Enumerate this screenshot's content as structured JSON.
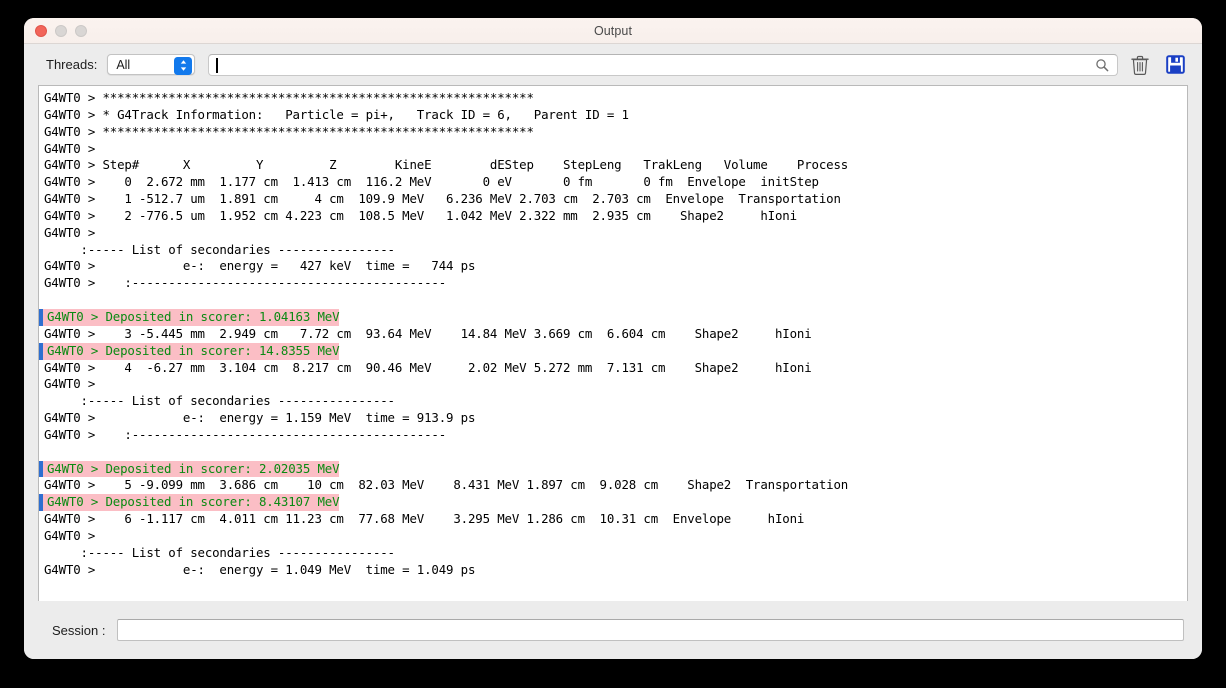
{
  "window": {
    "title": "Output",
    "traffic_lights": [
      "close",
      "minimize",
      "maximize"
    ]
  },
  "toolbar": {
    "threads_label": "Threads:",
    "threads_value": "All",
    "threads_options": [
      "All"
    ],
    "search_placeholder": "",
    "search_value": "",
    "search_icon": "search-icon",
    "clear_icon": "trash-icon",
    "save_icon": "save-floppy-icon"
  },
  "session": {
    "label": "Session :",
    "value": "",
    "placeholder": ""
  },
  "colors": {
    "highlight_background": "#fbbec5",
    "highlight_text": "#0a8a12",
    "highlight_bar": "#2f6fd0",
    "window_background": "#ececec",
    "titlebar_background": "#f8f0ec",
    "log_background": "#ffffff",
    "accent_blue": "#1279ec"
  },
  "log": {
    "lines": [
      {
        "text": "G4WT0 > ***********************************************************",
        "highlight": false
      },
      {
        "text": "G4WT0 > * G4Track Information:   Particle = pi+,   Track ID = 6,   Parent ID = 1",
        "highlight": false
      },
      {
        "text": "G4WT0 > ***********************************************************",
        "highlight": false
      },
      {
        "text": "G4WT0 > ",
        "highlight": false
      },
      {
        "text": "G4WT0 > Step#      X         Y         Z        KineE        dEStep    StepLeng   TrakLeng   Volume    Process",
        "highlight": false
      },
      {
        "text": "G4WT0 >    0  2.672 mm  1.177 cm  1.413 cm  116.2 MeV       0 eV       0 fm       0 fm  Envelope  initStep",
        "highlight": false
      },
      {
        "text": "G4WT0 >    1 -512.7 um  1.891 cm     4 cm  109.9 MeV   6.236 MeV 2.703 cm  2.703 cm  Envelope  Transportation",
        "highlight": false
      },
      {
        "text": "G4WT0 >    2 -776.5 um  1.952 cm 4.223 cm  108.5 MeV   1.042 MeV 2.322 mm  2.935 cm    Shape2     hIoni",
        "highlight": false
      },
      {
        "text": "G4WT0 > ",
        "highlight": false
      },
      {
        "text": "     :----- List of secondaries ----------------",
        "highlight": false
      },
      {
        "text": "G4WT0 >            e-:  energy =   427 keV  time =   744 ps",
        "highlight": false
      },
      {
        "text": "G4WT0 >    :-------------------------------------------",
        "highlight": false
      },
      {
        "text": "",
        "highlight": false
      },
      {
        "text": "G4WT0 > Deposited in scorer: 1.04163 MeV",
        "highlight": true
      },
      {
        "text": "G4WT0 >    3 -5.445 mm  2.949 cm   7.72 cm  93.64 MeV    14.84 MeV 3.669 cm  6.604 cm    Shape2     hIoni",
        "highlight": false
      },
      {
        "text": "G4WT0 > Deposited in scorer: 14.8355 MeV",
        "highlight": true
      },
      {
        "text": "G4WT0 >    4  -6.27 mm  3.104 cm  8.217 cm  90.46 MeV     2.02 MeV 5.272 mm  7.131 cm    Shape2     hIoni",
        "highlight": false
      },
      {
        "text": "G4WT0 > ",
        "highlight": false
      },
      {
        "text": "     :----- List of secondaries ----------------",
        "highlight": false
      },
      {
        "text": "G4WT0 >            e-:  energy = 1.159 MeV  time = 913.9 ps",
        "highlight": false
      },
      {
        "text": "G4WT0 >    :-------------------------------------------",
        "highlight": false
      },
      {
        "text": "",
        "highlight": false
      },
      {
        "text": "G4WT0 > Deposited in scorer: 2.02035 MeV",
        "highlight": true
      },
      {
        "text": "G4WT0 >    5 -9.099 mm  3.686 cm    10 cm  82.03 MeV    8.431 MeV 1.897 cm  9.028 cm    Shape2  Transportation",
        "highlight": false
      },
      {
        "text": "G4WT0 > Deposited in scorer: 8.43107 MeV",
        "highlight": true
      },
      {
        "text": "G4WT0 >    6 -1.117 cm  4.011 cm 11.23 cm  77.68 MeV    3.295 MeV 1.286 cm  10.31 cm  Envelope     hIoni",
        "highlight": false
      },
      {
        "text": "G4WT0 > ",
        "highlight": false
      },
      {
        "text": "     :----- List of secondaries ----------------",
        "highlight": false
      },
      {
        "text": "G4WT0 >            e-:  energy = 1.049 MeV  time = 1.049 ps",
        "highlight": false
      }
    ]
  }
}
